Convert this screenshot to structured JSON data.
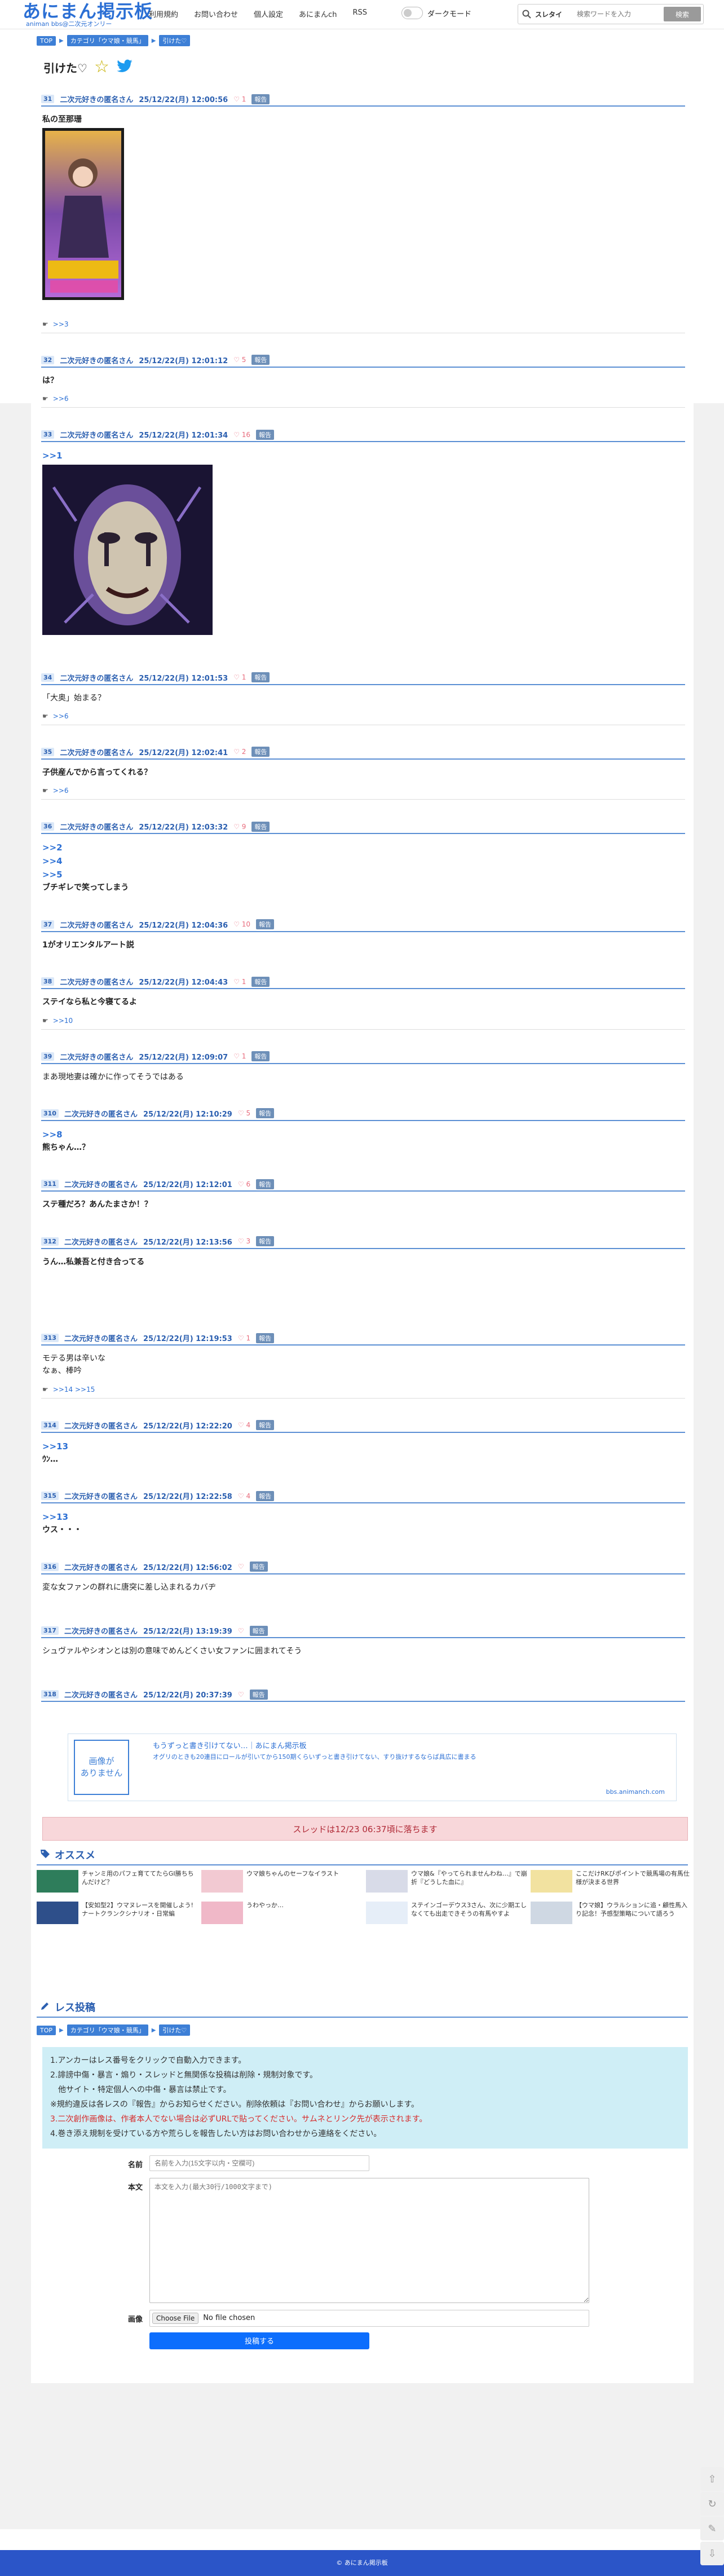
{
  "site": {
    "logo": "あにまん掲示板",
    "logo_sub": "animan bbs@二次元オンリー",
    "nav": [
      "利用規約",
      "お問い合わせ",
      "個人設定",
      "あにまんch",
      "RSS"
    ],
    "dark_mode_label": "ダークモード",
    "search": {
      "field": "スレタイ",
      "placeholder": "検索ワードを入力",
      "button": "検索"
    }
  },
  "breadcrumbs": [
    "TOP",
    "カテゴリ「ウマ娘・競馬」",
    "引けた♡"
  ],
  "thread": {
    "title": "引けた♡"
  },
  "posts": [
    {
      "no": "31",
      "name": "二次元好きの匿名さん",
      "date": "25/12/22(月) 12:00:56",
      "likes": "1",
      "report": "報告",
      "anchors": [],
      "text": [
        "私の至那珊"
      ],
      "bold": true,
      "image": "mayano",
      "replies": ">>3"
    },
    {
      "no": "32",
      "name": "二次元好きの匿名さん",
      "date": "25/12/22(月) 12:01:12",
      "likes": "5",
      "report": "報告",
      "anchors": [],
      "text": [
        "は？"
      ],
      "bold": true,
      "image": null,
      "replies": ">>6"
    },
    {
      "no": "33",
      "name": "二次元好きの匿名さん",
      "date": "25/12/22(月) 12:01:34",
      "likes": "16",
      "report": "報告",
      "anchors": [
        ">>1"
      ],
      "text": [],
      "bold": false,
      "image": "clown",
      "replies": null
    },
    {
      "no": "34",
      "name": "二次元好きの匿名さん",
      "date": "25/12/22(月) 12:01:53",
      "likes": "1",
      "report": "報告",
      "anchors": [],
      "text": [
        "「大奥」始まる？"
      ],
      "bold": false,
      "image": null,
      "replies": ">>6"
    },
    {
      "no": "35",
      "name": "二次元好きの匿名さん",
      "date": "25/12/22(月) 12:02:41",
      "likes": "2",
      "report": "報告",
      "anchors": [],
      "text": [
        "子供産んでから言ってくれる？"
      ],
      "bold": true,
      "image": null,
      "replies": ">>6"
    },
    {
      "no": "36",
      "name": "二次元好きの匿名さん",
      "date": "25/12/22(月) 12:03:32",
      "likes": "9",
      "report": "報告",
      "anchors": [
        ">>2",
        ">>4",
        ">>5"
      ],
      "text": [
        "ブチギレで笑ってしまう"
      ],
      "bold": true,
      "image": null,
      "replies": null
    },
    {
      "no": "37",
      "name": "二次元好きの匿名さん",
      "date": "25/12/22(月) 12:04:36",
      "likes": "10",
      "report": "報告",
      "anchors": [],
      "text": [
        "1がオリエンタルアート説"
      ],
      "bold": true,
      "image": null,
      "replies": null
    },
    {
      "no": "38",
      "name": "二次元好きの匿名さん",
      "date": "25/12/22(月) 12:04:43",
      "likes": "1",
      "report": "報告",
      "anchors": [],
      "text": [
        "ステイなら私と今寝てるよ"
      ],
      "bold": true,
      "image": null,
      "replies": ">>10"
    },
    {
      "no": "39",
      "name": "二次元好きの匿名さん",
      "date": "25/12/22(月) 12:09:07",
      "likes": "1",
      "report": "報告",
      "anchors": [],
      "text": [
        "まあ現地妻は確かに作ってそうではある"
      ],
      "bold": false,
      "image": null,
      "replies": null
    },
    {
      "no": "310",
      "name": "二次元好きの匿名さん",
      "date": "25/12/22(月) 12:10:29",
      "likes": "5",
      "report": "報告",
      "anchors": [
        ">>8"
      ],
      "text": [
        "熊ちゃん…？"
      ],
      "bold": true,
      "image": null,
      "replies": null
    },
    {
      "no": "311",
      "name": "二次元好きの匿名さん",
      "date": "25/12/22(月) 12:12:01",
      "likes": "6",
      "report": "報告",
      "anchors": [],
      "text": [
        "ステ種だろ？あんたまさか！？"
      ],
      "bold": true,
      "image": null,
      "replies": null
    },
    {
      "no": "312",
      "name": "二次元好きの匿名さん",
      "date": "25/12/22(月) 12:13:56",
      "likes": "3",
      "report": "報告",
      "anchors": [],
      "text": [
        "うん…私兼吾と付き合ってる"
      ],
      "bold": true,
      "image": null,
      "replies": null
    },
    {
      "no": "313",
      "name": "二次元好きの匿名さん",
      "date": "25/12/22(月) 12:19:53",
      "likes": "1",
      "report": "報告",
      "anchors": [],
      "text": [
        "モテる男は辛いな",
        "なぁ、棒吟"
      ],
      "bold": false,
      "image": null,
      "replies": ">>14 >>15"
    },
    {
      "no": "314",
      "name": "二次元好きの匿名さん",
      "date": "25/12/22(月) 12:22:20",
      "likes": "4",
      "report": "報告",
      "anchors": [
        ">>13"
      ],
      "text": [
        "ｳﾝ…"
      ],
      "bold": true,
      "image": null,
      "replies": null
    },
    {
      "no": "315",
      "name": "二次元好きの匿名さん",
      "date": "25/12/22(月) 12:22:58",
      "likes": "4",
      "report": "報告",
      "anchors": [
        ">>13"
      ],
      "text": [
        "ウス・・・"
      ],
      "bold": true,
      "image": null,
      "replies": null
    },
    {
      "no": "316",
      "name": "二次元好きの匿名さん",
      "date": "25/12/22(月) 12:56:02",
      "likes": "",
      "report": "報告",
      "anchors": [],
      "text": [
        "変な女ファンの群れに唐突に差し込まれるカバヂ"
      ],
      "bold": false,
      "image": null,
      "replies": null
    },
    {
      "no": "317",
      "name": "二次元好きの匿名さん",
      "date": "25/12/22(月) 13:19:39",
      "likes": "",
      "report": "報告",
      "anchors": [],
      "text": [
        "シュヴァルやシオンとは別の意味でめんどくさい女ファンに囲まれてそう"
      ],
      "bold": false,
      "image": null,
      "replies": null
    },
    {
      "no": "318",
      "name": "二次元好きの匿名さん",
      "date": "25/12/22(月) 20:37:39",
      "likes": "",
      "report": "報告",
      "anchors": [],
      "text": [],
      "bold": false,
      "image": null,
      "replies": null
    }
  ],
  "link_card": {
    "image_text": "画像が\nありません",
    "title": "もうずっと書き引けてない…｜あにまん掲示板",
    "desc": "オグリのときも20連目にロールが引いてから150期くらいずっと書き引けてない、すり抜けするならば具広に書まる",
    "domain": "bbs.animanch.com"
  },
  "fall_notice": "スレッドは12/23 06:37頃に落ちます",
  "recommend": {
    "heading": "オススメ",
    "items": [
      "チャンミ用のパフェ育ててたらGI勝ちちんだけど？",
      "ウマ娘ちゃんのセーフなイラスト",
      "ウマ娘&『やってられませんわね…』で崩折『どうした血に』",
      "ここだけRKびポイントで競馬場の有馬仕様が決まる世界",
      "【安如型2】ウマヌレースを開催しよう!ナートクランクシナリオ・日常編",
      "うわやっか…",
      "ステインゴーデウス3さん、次に少期エしなくても出走できそうの有馬やすよ",
      "【ウマ娘】ウラルションに追・顧性馬入り記念！予感型策略について語ろう"
    ]
  },
  "post_form": {
    "heading": "レス投稿",
    "crumbs": [
      "TOP",
      "カテゴリ「ウマ娘・競馬」",
      "引けた♡"
    ],
    "rules": [
      "1.アンカーはレス番号をクリックで自動入力できます。",
      "2.誹謗中傷・暴言・煽り・スレッドと無関係な投稿は削除・規制対象です。",
      "　他サイト・特定個人への中傷・暴言は禁止です。",
      "※規約違反は各レスの『報告』からお知らせください。削除依頼は『お問い合わせ』からお願いします。",
      "3.二次創作画像は、作者本人でない場合は必ずURLで貼ってください。サムネとリンク先が表示されます。",
      "4.巻き添え規制を受けている方や荒らしを報告したい方はお問い合わせから連絡をください。"
    ],
    "name_label": "名前",
    "name_placeholder": "名前を入力(15文字以内・空欄可)",
    "body_label": "本文",
    "body_placeholder": "本文を入力(最大30行/1000文字まで)",
    "image_label": "画像",
    "file_button": "Choose File",
    "file_status": "No file chosen",
    "submit": "投稿する"
  },
  "footer": "© あにまん掲示板",
  "colors": {
    "brand": "#2b6fd4",
    "accent_line": "#5b8fd4",
    "footer": "#2b55c8",
    "submit": "#0d6efd"
  }
}
